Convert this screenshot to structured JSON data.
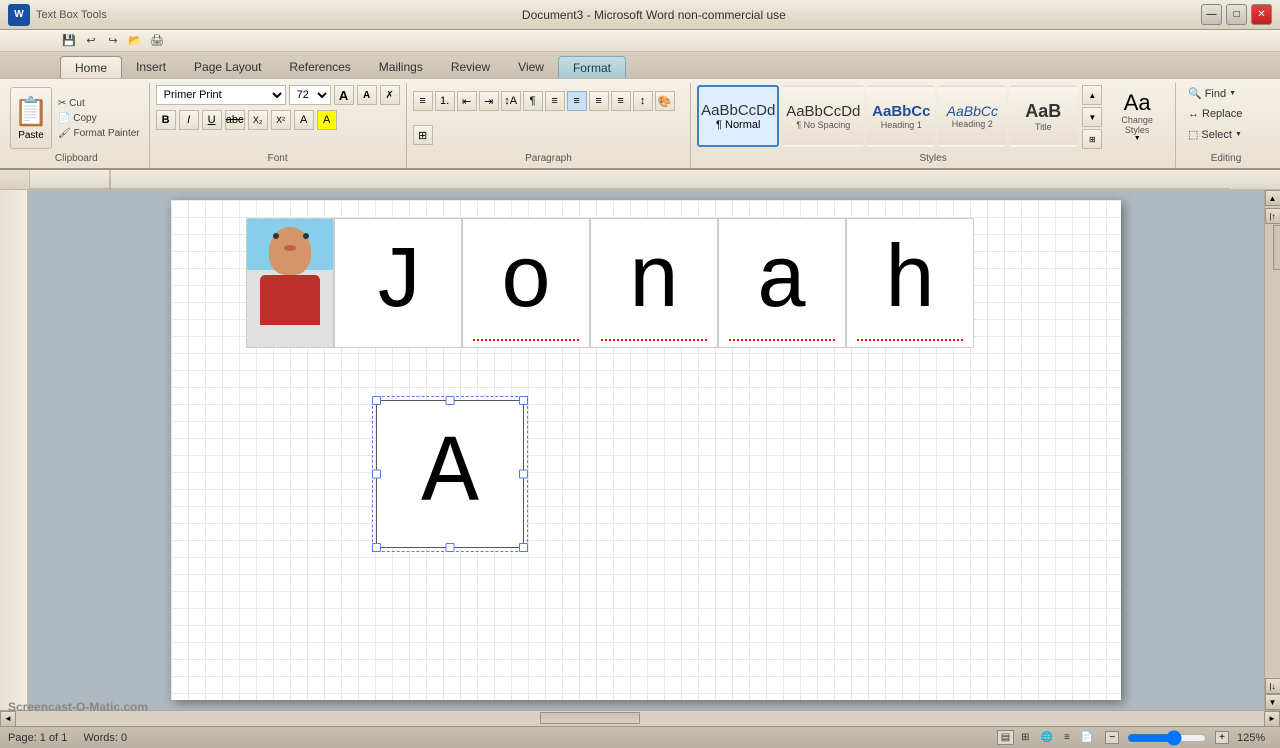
{
  "titlebar": {
    "title": "Document3 - Microsoft Word non-commercial use",
    "toolbar_label": "Text Box Tools",
    "minimize": "—",
    "maximize": "□",
    "close": "✕"
  },
  "quick_toolbar": {
    "buttons": [
      "💾",
      "↩",
      "↪",
      "📂",
      "🖨",
      "✂",
      "📋",
      "📄"
    ]
  },
  "tabs": [
    {
      "label": "Home",
      "active": true
    },
    {
      "label": "Insert"
    },
    {
      "label": "Page Layout"
    },
    {
      "label": "References"
    },
    {
      "label": "Mailings"
    },
    {
      "label": "Review"
    },
    {
      "label": "View"
    },
    {
      "label": "Format",
      "special": true
    }
  ],
  "ribbon": {
    "clipboard": {
      "label": "Clipboard",
      "paste": "Paste",
      "cut": "Cut",
      "copy": "Copy",
      "format_painter": "Format Painter"
    },
    "font": {
      "label": "Font",
      "font_name": "Primer Print",
      "font_size": "72",
      "bold": "B",
      "italic": "I",
      "underline": "U",
      "strikethrough": "abc",
      "subscript": "X₂",
      "superscript": "X²",
      "grow": "A",
      "shrink": "A"
    },
    "paragraph": {
      "label": "Paragraph"
    },
    "styles": {
      "label": "Styles",
      "items": [
        {
          "label": "Normal",
          "text": "AaBbCcDd",
          "tag": "¶"
        },
        {
          "label": "No Spacing",
          "text": "AaBbCcDd",
          "tag": "¶"
        },
        {
          "label": "Heading 1",
          "text": "AaBbCc",
          "tag": ""
        },
        {
          "label": "Heading 2",
          "text": "AaBbCc",
          "tag": ""
        },
        {
          "label": "Title",
          "text": "AaB",
          "tag": ""
        },
        {
          "label": "Heading",
          "text": "",
          "tag": ""
        },
        {
          "label": "Heading 2",
          "text": "",
          "tag": ""
        },
        {
          "label": "Change Styles",
          "text": "",
          "tag": ""
        }
      ]
    },
    "editing": {
      "label": "Editing",
      "find": "Find",
      "replace": "Replace",
      "select": "Select"
    }
  },
  "document": {
    "letters": [
      "J",
      "o",
      "n",
      "a",
      "h"
    ],
    "textbox_letter": "A",
    "zoom": "125%"
  },
  "statusbar": {
    "page_info": "Page: 1 of 1",
    "words": "Words: 0",
    "zoom": "125%"
  },
  "watermark": "Screencast-O-Matic.com"
}
